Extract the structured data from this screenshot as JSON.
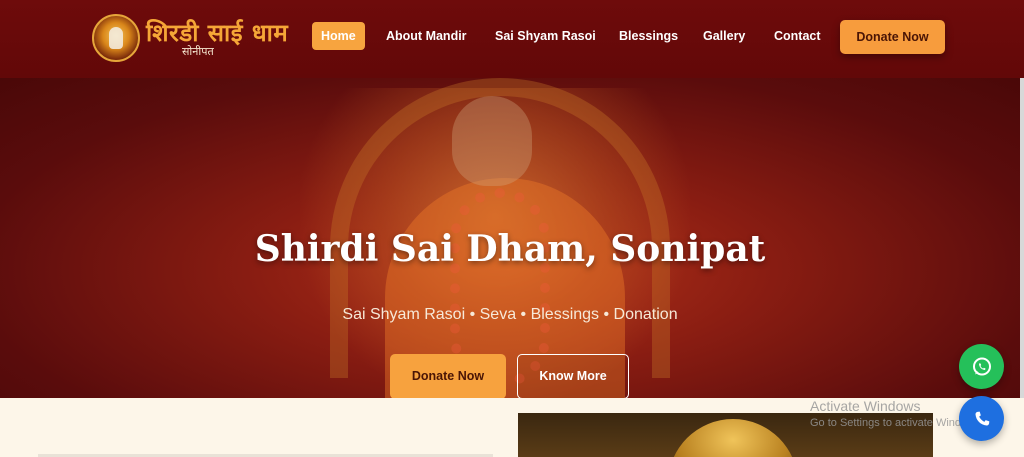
{
  "brand": {
    "title": "शिरडी साई धाम",
    "subtitle": "सोनीपत",
    "emblem_icon": "sai-baba-emblem"
  },
  "nav": {
    "items": [
      {
        "label": "Home",
        "active": true
      },
      {
        "label": "About Mandir",
        "active": false
      },
      {
        "label": "Sai Shyam Rasoi",
        "active": false
      },
      {
        "label": "Blessings",
        "active": false
      },
      {
        "label": "Gallery",
        "active": false
      },
      {
        "label": "Contact",
        "active": false
      }
    ],
    "donate_label": "Donate Now"
  },
  "hero": {
    "title": "Shirdi Sai Dham, Sonipat",
    "subtitle": "Sai Shyam Rasoi • Seva • Blessings • Donation",
    "primary_button": "Donate Now",
    "secondary_button": "Know More"
  },
  "floating": {
    "whatsapp_icon": "whatsapp-icon",
    "phone_icon": "phone-icon"
  },
  "os_watermark": {
    "title": "Activate Windows",
    "subtitle": "Go to Settings to activate Windows."
  },
  "colors": {
    "header_bg": "#6b0a0a",
    "accent": "#f7a43f",
    "logo_text": "#f5a637",
    "whatsapp": "#25c05a",
    "phone": "#1e6fe0"
  }
}
